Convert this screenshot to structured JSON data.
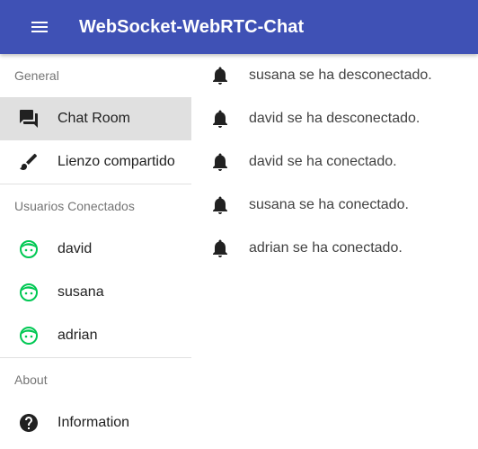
{
  "appbar": {
    "title": "WebSocket-WebRTC-Chat",
    "menu_icon": "menu-icon",
    "color": "#3f51b5"
  },
  "drawer": {
    "sections": [
      {
        "header": "General",
        "items": [
          {
            "label": "Chat Room",
            "icon": "chat-icon",
            "selected": true
          },
          {
            "label": "Lienzo compartido",
            "icon": "brush-icon",
            "selected": false
          }
        ]
      },
      {
        "header": "Usuarios Conectados",
        "items": [
          {
            "label": "david",
            "icon": "face-icon"
          },
          {
            "label": "susana",
            "icon": "face-icon"
          },
          {
            "label": "adrian",
            "icon": "face-icon"
          }
        ]
      },
      {
        "header": "About",
        "items": [
          {
            "label": "Information",
            "icon": "help-icon"
          }
        ]
      }
    ],
    "user_icon_color": "#00c853"
  },
  "messages": [
    {
      "text": "susana se ha desconectado.",
      "icon": "bell-icon"
    },
    {
      "text": "david se ha desconectado.",
      "icon": "bell-icon"
    },
    {
      "text": "david se ha conectado.",
      "icon": "bell-icon"
    },
    {
      "text": "susana se ha conectado.",
      "icon": "bell-icon"
    },
    {
      "text": "adrian se ha conectado.",
      "icon": "bell-icon"
    }
  ]
}
